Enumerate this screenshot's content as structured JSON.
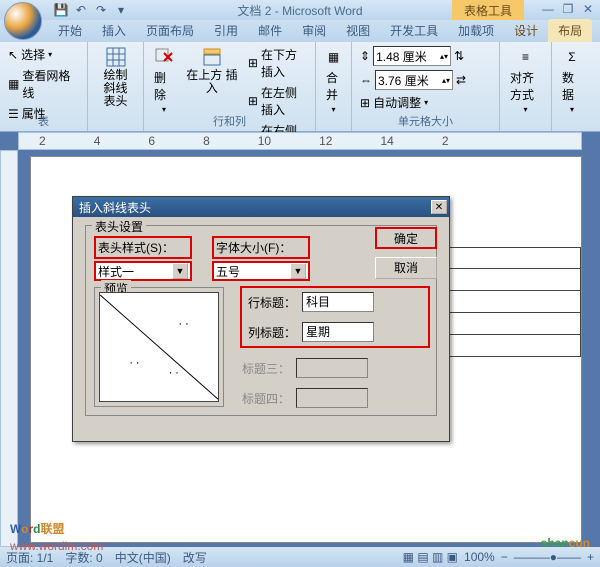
{
  "title": "文档 2 - Microsoft Word",
  "context_tab": "表格工具",
  "qat": {
    "save": "💾",
    "undo": "↶",
    "redo": "↷",
    "more": "▾"
  },
  "window_controls": {
    "min": "—",
    "restore": "❐",
    "close": "✕"
  },
  "tabs": [
    "开始",
    "插入",
    "页面布局",
    "引用",
    "邮件",
    "审阅",
    "视图",
    "开发工具",
    "加载项",
    "设计",
    "布局"
  ],
  "ribbon": {
    "group1": {
      "select": "选择",
      "gridlines": "查看网格线",
      "properties": "属性",
      "label": "表"
    },
    "group2": {
      "diagonal": "绘制\n斜线表头",
      "label": ""
    },
    "group3": {
      "delete": "删除",
      "insert_above": "在上方\n插入",
      "insert_below": "在下方插入",
      "insert_left": "在左侧插入",
      "insert_right": "在右侧插入",
      "label": "行和列"
    },
    "group4": {
      "merge": "合并",
      "label": ""
    },
    "group5": {
      "height": "1.48 厘米",
      "width": "3.76 厘米",
      "autofit": "自动调整",
      "dist_rows": "⇅",
      "dist_cols": "⇄",
      "label": "单元格大小"
    },
    "group6": {
      "align": "对齐方式",
      "data": "数据",
      "label": ""
    }
  },
  "ruler": [
    "2",
    "4",
    "6",
    "8",
    "10",
    "12",
    "14",
    "2"
  ],
  "dialog": {
    "title": "插入斜线表头",
    "fieldset_label": "表头设置",
    "style_label": "表头样式(S)：",
    "style_value": "样式一",
    "fontsize_label": "字体大小(F)：",
    "fontsize_value": "五号",
    "preview_label": "预览",
    "row_title_label": "行标题：",
    "row_title_value": "科目",
    "col_title_label": "列标题：",
    "col_title_value": "星期",
    "title3_label": "标题三：",
    "title3_value": "",
    "title4_label": "标题四：",
    "title4_value": "",
    "ok": "确定",
    "cancel": "取消"
  },
  "statusbar": {
    "page": "页面: 1/1",
    "words": "字数: 0",
    "lang": "中文(中国)",
    "mode": "改写",
    "zoom": "100%",
    "minus": "−",
    "plus": "+"
  },
  "watermark": {
    "word": "Word联盟",
    "url": "www.wordlm.com",
    "shancun": "shancun"
  }
}
